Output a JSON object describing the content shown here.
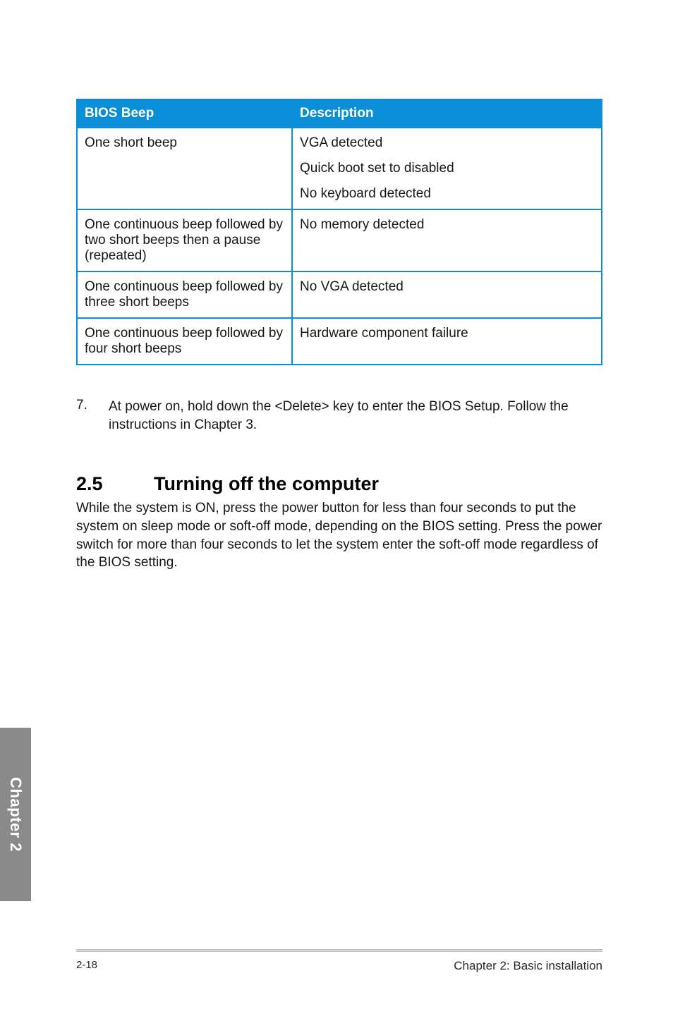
{
  "table": {
    "headers": [
      "BIOS Beep",
      "Description"
    ],
    "rows": [
      {
        "beep": "One short beep",
        "desc": [
          "VGA detected",
          "Quick boot set to disabled",
          "No keyboard detected"
        ]
      },
      {
        "beep": "One continuous beep followed by two short beeps then a pause (repeated)",
        "desc": [
          "No memory detected"
        ]
      },
      {
        "beep": "One continuous beep followed by three short beeps",
        "desc": [
          "No VGA detected"
        ]
      },
      {
        "beep": "One continuous beep followed by four short beeps",
        "desc": [
          "Hardware component failure"
        ]
      }
    ]
  },
  "step": {
    "num": "7.",
    "text": "At power on, hold down the <Delete> key to enter the BIOS Setup. Follow the instructions in Chapter 3."
  },
  "section": {
    "num": "2.5",
    "title": "Turning off the computer",
    "body": "While the system is ON, press the power button for less than four seconds to put the system on sleep mode or soft-off mode, depending on the BIOS setting. Press the power switch for more than four seconds to let the system enter the soft-off mode regardless of the BIOS setting."
  },
  "sidetab": "Chapter 2",
  "footer": {
    "page": "2-18",
    "chapter": "Chapter 2: Basic installation"
  }
}
